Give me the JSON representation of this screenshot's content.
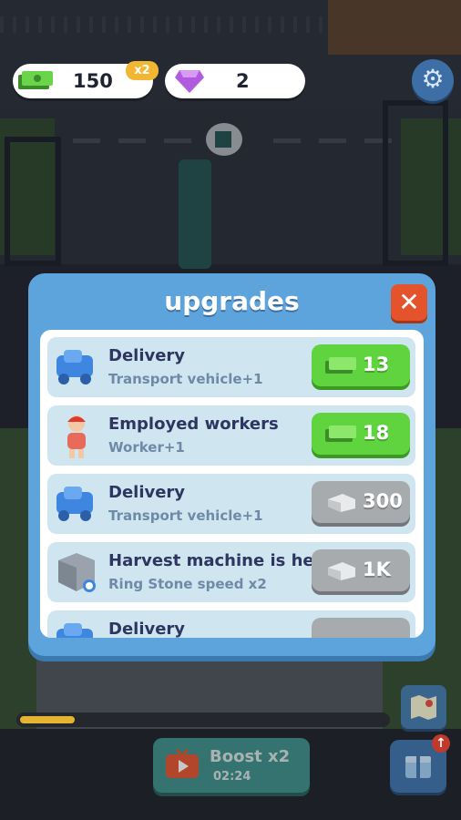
{
  "hud": {
    "cash": "150",
    "cash_multiplier": "x2",
    "gems": "2"
  },
  "modal": {
    "title": "upgrades",
    "close_label": "✕",
    "items": [
      {
        "name": "Delivery",
        "sub": "Transport vehicle+1",
        "price": "13",
        "currency": "cash",
        "affordable": true,
        "icon": "blue-truck-icon"
      },
      {
        "name": "Employed workers",
        "sub": "Worker+1",
        "price": "18",
        "currency": "cash",
        "affordable": true,
        "icon": "worker-icon"
      },
      {
        "name": "Delivery",
        "sub": "Transport vehicle+1",
        "price": "300",
        "currency": "stone",
        "affordable": false,
        "icon": "blue-truck-icon"
      },
      {
        "name": "Harvest machine is here",
        "sub": "Ring Stone speed x2",
        "price": "1K",
        "currency": "stone",
        "affordable": false,
        "icon": "stone-block-icon"
      },
      {
        "name": "Delivery",
        "sub": "",
        "price": "",
        "currency": "stone",
        "affordable": false,
        "icon": "blue-truck-icon"
      }
    ]
  },
  "bottom": {
    "progress": 0.15,
    "boost_label": "Boost x2",
    "boost_time": "02:24"
  },
  "colors": {
    "modal_bg": "#5da4dc",
    "buy_green": "#5fd43f",
    "locked_gray": "#a8abae",
    "close_red": "#e4532c"
  }
}
